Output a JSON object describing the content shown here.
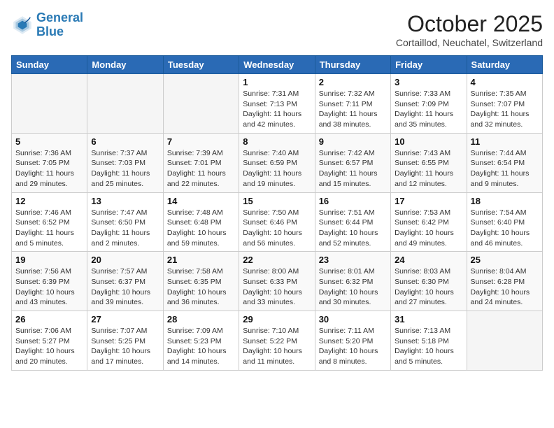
{
  "header": {
    "logo_line1": "General",
    "logo_line2": "Blue",
    "month": "October 2025",
    "location": "Cortaillod, Neuchatel, Switzerland"
  },
  "weekdays": [
    "Sunday",
    "Monday",
    "Tuesday",
    "Wednesday",
    "Thursday",
    "Friday",
    "Saturday"
  ],
  "weeks": [
    [
      {
        "day": "",
        "sunrise": "",
        "sunset": "",
        "daylight": ""
      },
      {
        "day": "",
        "sunrise": "",
        "sunset": "",
        "daylight": ""
      },
      {
        "day": "",
        "sunrise": "",
        "sunset": "",
        "daylight": ""
      },
      {
        "day": "1",
        "sunrise": "Sunrise: 7:31 AM",
        "sunset": "Sunset: 7:13 PM",
        "daylight": "Daylight: 11 hours and 42 minutes."
      },
      {
        "day": "2",
        "sunrise": "Sunrise: 7:32 AM",
        "sunset": "Sunset: 7:11 PM",
        "daylight": "Daylight: 11 hours and 38 minutes."
      },
      {
        "day": "3",
        "sunrise": "Sunrise: 7:33 AM",
        "sunset": "Sunset: 7:09 PM",
        "daylight": "Daylight: 11 hours and 35 minutes."
      },
      {
        "day": "4",
        "sunrise": "Sunrise: 7:35 AM",
        "sunset": "Sunset: 7:07 PM",
        "daylight": "Daylight: 11 hours and 32 minutes."
      }
    ],
    [
      {
        "day": "5",
        "sunrise": "Sunrise: 7:36 AM",
        "sunset": "Sunset: 7:05 PM",
        "daylight": "Daylight: 11 hours and 29 minutes."
      },
      {
        "day": "6",
        "sunrise": "Sunrise: 7:37 AM",
        "sunset": "Sunset: 7:03 PM",
        "daylight": "Daylight: 11 hours and 25 minutes."
      },
      {
        "day": "7",
        "sunrise": "Sunrise: 7:39 AM",
        "sunset": "Sunset: 7:01 PM",
        "daylight": "Daylight: 11 hours and 22 minutes."
      },
      {
        "day": "8",
        "sunrise": "Sunrise: 7:40 AM",
        "sunset": "Sunset: 6:59 PM",
        "daylight": "Daylight: 11 hours and 19 minutes."
      },
      {
        "day": "9",
        "sunrise": "Sunrise: 7:42 AM",
        "sunset": "Sunset: 6:57 PM",
        "daylight": "Daylight: 11 hours and 15 minutes."
      },
      {
        "day": "10",
        "sunrise": "Sunrise: 7:43 AM",
        "sunset": "Sunset: 6:55 PM",
        "daylight": "Daylight: 11 hours and 12 minutes."
      },
      {
        "day": "11",
        "sunrise": "Sunrise: 7:44 AM",
        "sunset": "Sunset: 6:54 PM",
        "daylight": "Daylight: 11 hours and 9 minutes."
      }
    ],
    [
      {
        "day": "12",
        "sunrise": "Sunrise: 7:46 AM",
        "sunset": "Sunset: 6:52 PM",
        "daylight": "Daylight: 11 hours and 5 minutes."
      },
      {
        "day": "13",
        "sunrise": "Sunrise: 7:47 AM",
        "sunset": "Sunset: 6:50 PM",
        "daylight": "Daylight: 11 hours and 2 minutes."
      },
      {
        "day": "14",
        "sunrise": "Sunrise: 7:48 AM",
        "sunset": "Sunset: 6:48 PM",
        "daylight": "Daylight: 10 hours and 59 minutes."
      },
      {
        "day": "15",
        "sunrise": "Sunrise: 7:50 AM",
        "sunset": "Sunset: 6:46 PM",
        "daylight": "Daylight: 10 hours and 56 minutes."
      },
      {
        "day": "16",
        "sunrise": "Sunrise: 7:51 AM",
        "sunset": "Sunset: 6:44 PM",
        "daylight": "Daylight: 10 hours and 52 minutes."
      },
      {
        "day": "17",
        "sunrise": "Sunrise: 7:53 AM",
        "sunset": "Sunset: 6:42 PM",
        "daylight": "Daylight: 10 hours and 49 minutes."
      },
      {
        "day": "18",
        "sunrise": "Sunrise: 7:54 AM",
        "sunset": "Sunset: 6:40 PM",
        "daylight": "Daylight: 10 hours and 46 minutes."
      }
    ],
    [
      {
        "day": "19",
        "sunrise": "Sunrise: 7:56 AM",
        "sunset": "Sunset: 6:39 PM",
        "daylight": "Daylight: 10 hours and 43 minutes."
      },
      {
        "day": "20",
        "sunrise": "Sunrise: 7:57 AM",
        "sunset": "Sunset: 6:37 PM",
        "daylight": "Daylight: 10 hours and 39 minutes."
      },
      {
        "day": "21",
        "sunrise": "Sunrise: 7:58 AM",
        "sunset": "Sunset: 6:35 PM",
        "daylight": "Daylight: 10 hours and 36 minutes."
      },
      {
        "day": "22",
        "sunrise": "Sunrise: 8:00 AM",
        "sunset": "Sunset: 6:33 PM",
        "daylight": "Daylight: 10 hours and 33 minutes."
      },
      {
        "day": "23",
        "sunrise": "Sunrise: 8:01 AM",
        "sunset": "Sunset: 6:32 PM",
        "daylight": "Daylight: 10 hours and 30 minutes."
      },
      {
        "day": "24",
        "sunrise": "Sunrise: 8:03 AM",
        "sunset": "Sunset: 6:30 PM",
        "daylight": "Daylight: 10 hours and 27 minutes."
      },
      {
        "day": "25",
        "sunrise": "Sunrise: 8:04 AM",
        "sunset": "Sunset: 6:28 PM",
        "daylight": "Daylight: 10 hours and 24 minutes."
      }
    ],
    [
      {
        "day": "26",
        "sunrise": "Sunrise: 7:06 AM",
        "sunset": "Sunset: 5:27 PM",
        "daylight": "Daylight: 10 hours and 20 minutes."
      },
      {
        "day": "27",
        "sunrise": "Sunrise: 7:07 AM",
        "sunset": "Sunset: 5:25 PM",
        "daylight": "Daylight: 10 hours and 17 minutes."
      },
      {
        "day": "28",
        "sunrise": "Sunrise: 7:09 AM",
        "sunset": "Sunset: 5:23 PM",
        "daylight": "Daylight: 10 hours and 14 minutes."
      },
      {
        "day": "29",
        "sunrise": "Sunrise: 7:10 AM",
        "sunset": "Sunset: 5:22 PM",
        "daylight": "Daylight: 10 hours and 11 minutes."
      },
      {
        "day": "30",
        "sunrise": "Sunrise: 7:11 AM",
        "sunset": "Sunset: 5:20 PM",
        "daylight": "Daylight: 10 hours and 8 minutes."
      },
      {
        "day": "31",
        "sunrise": "Sunrise: 7:13 AM",
        "sunset": "Sunset: 5:18 PM",
        "daylight": "Daylight: 10 hours and 5 minutes."
      },
      {
        "day": "",
        "sunrise": "",
        "sunset": "",
        "daylight": ""
      }
    ]
  ]
}
